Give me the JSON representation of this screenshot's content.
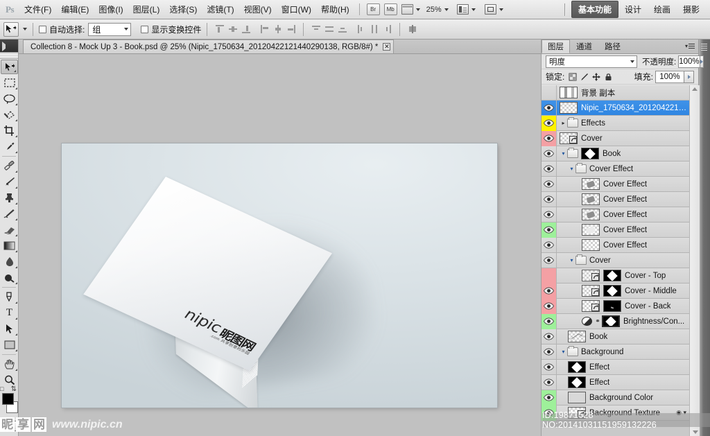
{
  "app": {
    "name": "Adobe Photoshop",
    "logo_text": "Ps"
  },
  "menubar": {
    "items": [
      {
        "label": "文件(F)",
        "name": "menu-file"
      },
      {
        "label": "编辑(E)",
        "name": "menu-edit"
      },
      {
        "label": "图像(I)",
        "name": "menu-image"
      },
      {
        "label": "图层(L)",
        "name": "menu-layer"
      },
      {
        "label": "选择(S)",
        "name": "menu-select"
      },
      {
        "label": "滤镜(T)",
        "name": "menu-filter"
      },
      {
        "label": "视图(V)",
        "name": "menu-view"
      },
      {
        "label": "窗口(W)",
        "name": "menu-window"
      },
      {
        "label": "帮助(H)",
        "name": "menu-help"
      }
    ],
    "bridge_label": "Br",
    "minibridge_label": "Mb",
    "zoom_level": "25%",
    "workspaces": [
      {
        "label": "基本功能",
        "active": true
      },
      {
        "label": "设计",
        "active": false
      },
      {
        "label": "绘画",
        "active": false
      },
      {
        "label": "摄影",
        "active": false
      }
    ]
  },
  "options_bar": {
    "tool_icon": "move-tool-icon",
    "auto_select_label": "自动选择:",
    "auto_select_checked": false,
    "auto_select_value": "组",
    "show_transform_label": "显示变换控件",
    "show_transform_checked": false
  },
  "toolbox": {
    "tools": [
      {
        "name": "move-tool",
        "label": "移动工具",
        "selected": true
      },
      {
        "name": "rectangular-marquee-tool",
        "label": "矩形选框工具",
        "selected": false
      },
      {
        "name": "lasso-tool",
        "label": "套索工具",
        "selected": false
      },
      {
        "name": "quick-selection-tool",
        "label": "快速选择工具",
        "selected": false
      },
      {
        "name": "crop-tool",
        "label": "裁剪工具",
        "selected": false
      },
      {
        "name": "eyedropper-tool",
        "label": "吸管工具",
        "selected": false
      },
      {
        "name": "spot-healing-brush-tool",
        "label": "修复画笔工具",
        "selected": false
      },
      {
        "name": "brush-tool",
        "label": "画笔工具",
        "selected": false
      },
      {
        "name": "clone-stamp-tool",
        "label": "仿制图章工具",
        "selected": false
      },
      {
        "name": "history-brush-tool",
        "label": "历史记录画笔工具",
        "selected": false
      },
      {
        "name": "eraser-tool",
        "label": "橡皮擦工具",
        "selected": false
      },
      {
        "name": "gradient-tool",
        "label": "渐变工具",
        "selected": false
      },
      {
        "name": "blur-tool",
        "label": "模糊工具",
        "selected": false
      },
      {
        "name": "dodge-tool",
        "label": "减淡工具",
        "selected": false
      },
      {
        "name": "pen-tool",
        "label": "钢笔工具",
        "selected": false
      },
      {
        "name": "type-tool",
        "label": "文字工具",
        "selected": false
      },
      {
        "name": "path-selection-tool",
        "label": "路径选择工具",
        "selected": false
      },
      {
        "name": "rectangle-tool",
        "label": "矩形工具",
        "selected": false
      },
      {
        "name": "hand-tool",
        "label": "抓手工具",
        "selected": false
      },
      {
        "name": "zoom-tool",
        "label": "缩放工具",
        "selected": false
      }
    ],
    "foreground_color": "#000000",
    "background_color": "#ffffff",
    "quick_mask_label": "快速蒙版"
  },
  "document": {
    "tab_title": "Collection 8 - Mock Up 3 - Book.psd @ 25% (Nipic_1750634_20120422121440290138, RGB/8#) *",
    "close_glyph": "✕",
    "canvas": {
      "background_color": "#d5dde1",
      "mockup_description": "white hardcover book mockup",
      "cover_watermark_en": "nipic",
      "cover_watermark_cn": "昵图网",
      "cover_watermark_sub": ".com 共享创意的乐园"
    }
  },
  "layers_panel": {
    "tabs": [
      {
        "label": "图层",
        "active": true
      },
      {
        "label": "通道",
        "active": false
      },
      {
        "label": "路径",
        "active": false
      }
    ],
    "blend_mode": "明度",
    "opacity_label": "不透明度:",
    "opacity_value": "100%",
    "lock_label": "锁定:",
    "fill_label": "填充:",
    "fill_value": "100%",
    "accent_selected": "#2f86e2",
    "highlight_yellow": "#fff200",
    "highlight_pink": "#f4a0a4",
    "highlight_green": "#9ef09a",
    "layers": [
      {
        "name": "背景 副本",
        "visible": false,
        "indent": 0,
        "kind": "pixel-stripes",
        "highlight": "none",
        "selected": false
      },
      {
        "name": "Nipic_1750634_2012042212...",
        "visible": true,
        "indent": 0,
        "kind": "pixel-empty",
        "highlight": "none",
        "selected": true
      },
      {
        "name": "Effects",
        "visible": true,
        "indent": 0,
        "kind": "group-closed",
        "highlight": "yellow",
        "selected": false
      },
      {
        "name": "Cover",
        "visible": true,
        "indent": 0,
        "kind": "smart-object",
        "highlight": "pink",
        "selected": false
      },
      {
        "name": "Book",
        "visible": true,
        "indent": 0,
        "kind": "group-open-mask",
        "highlight": "none",
        "selected": false
      },
      {
        "name": "Cover Effect",
        "visible": true,
        "indent": 1,
        "kind": "group-open",
        "highlight": "none",
        "selected": false
      },
      {
        "name": "Cover Effect",
        "visible": true,
        "indent": 2,
        "kind": "pixel-blob",
        "highlight": "none",
        "selected": false
      },
      {
        "name": "Cover Effect",
        "visible": true,
        "indent": 2,
        "kind": "pixel-blob",
        "highlight": "none",
        "selected": false
      },
      {
        "name": "Cover Effect",
        "visible": true,
        "indent": 2,
        "kind": "pixel-blob",
        "highlight": "none",
        "selected": false
      },
      {
        "name": "Cover Effect",
        "visible": true,
        "indent": 2,
        "kind": "pixel-soft",
        "highlight": "green",
        "selected": false
      },
      {
        "name": "Cover Effect",
        "visible": true,
        "indent": 2,
        "kind": "pixel-empty",
        "highlight": "none",
        "selected": false
      },
      {
        "name": "Cover",
        "visible": true,
        "indent": 1,
        "kind": "group-open",
        "highlight": "none",
        "selected": false
      },
      {
        "name": "Cover - Top",
        "visible": false,
        "indent": 2,
        "kind": "smart-mask",
        "highlight": "pink",
        "selected": false
      },
      {
        "name": "Cover - Middle",
        "visible": true,
        "indent": 2,
        "kind": "smart-mask",
        "highlight": "pink",
        "selected": false
      },
      {
        "name": "Cover - Back",
        "visible": true,
        "indent": 2,
        "kind": "smart-mask-sparse",
        "highlight": "pink",
        "selected": false
      },
      {
        "name": "Brightness/Con...",
        "visible": true,
        "indent": 2,
        "kind": "adjustment",
        "highlight": "green",
        "selected": false
      },
      {
        "name": "Book",
        "visible": true,
        "indent": 1,
        "kind": "pixel-line",
        "highlight": "none",
        "selected": false
      },
      {
        "name": "Background",
        "visible": true,
        "indent": 0,
        "kind": "group-open",
        "highlight": "none",
        "selected": false
      },
      {
        "name": "Effect",
        "visible": true,
        "indent": 1,
        "kind": "mask-diamond",
        "highlight": "none",
        "selected": false
      },
      {
        "name": "Effect",
        "visible": true,
        "indent": 1,
        "kind": "mask-diamond",
        "highlight": "none",
        "selected": false
      },
      {
        "name": "Background Color",
        "visible": true,
        "indent": 1,
        "kind": "solid-white",
        "highlight": "green",
        "selected": false
      },
      {
        "name": "Background Texture",
        "visible": true,
        "indent": 1,
        "kind": "smart-object",
        "highlight": "green",
        "selected": false,
        "fx": "◉ ▾"
      }
    ]
  },
  "watermarks": {
    "right_overlay": "ID:19871528 NO:20141031151959132226",
    "left_logo_chars": [
      "昵",
      "享",
      "网"
    ],
    "left_url": "www.nipic.cn"
  }
}
